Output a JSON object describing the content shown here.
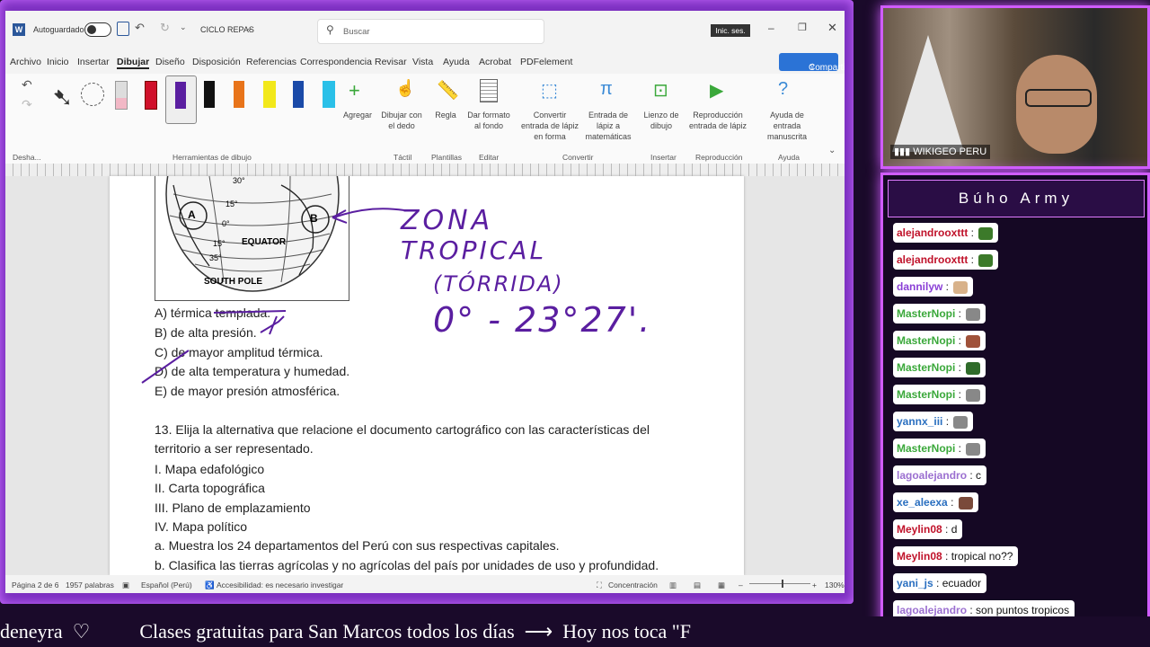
{
  "word": {
    "autosave_label": "Autoguardado",
    "doc_name": "CICLO REPAS",
    "search_placeholder": "Buscar",
    "signin_label": "Inic. ses.",
    "share_label": "Compartir",
    "menu": [
      "Archivo",
      "Inicio",
      "Insertar",
      "Dibujar",
      "Diseño",
      "Disposición",
      "Referencias",
      "Correspondencia",
      "Revisar",
      "Vista",
      "Ayuda",
      "Acrobat",
      "PDFelement"
    ],
    "ribbon": {
      "undo_group": "Desha...",
      "drawing_tools_group": "Herramientas de dibujo",
      "add_label": "Agregar",
      "draw_finger": "Dibujar con el dedo",
      "ruler": "Regla",
      "format_bg": "Dar formato al fondo",
      "ink_to_shape": "Convertir entrada de lápiz en forma",
      "ink_to_math": "Entrada de lápiz a matemáticas",
      "canvas": "Lienzo de dibujo",
      "ink_replay": "Reproducción entrada de lápiz",
      "ink_help": "Ayuda de entrada manuscrita",
      "groups": [
        "Táctil",
        "Plantillas",
        "Editar",
        "Convertir",
        "Insertar",
        "Reproducción",
        "Ayuda"
      ]
    },
    "figure": {
      "label_a": "A",
      "label_b": "B",
      "lat_30": "30°",
      "lat_15": "15°",
      "lat_0": "0°",
      "lat_s15": "15°",
      "lat_s35": "35°",
      "equator": "EQUATOR",
      "south_pole": "SOUTH POLE"
    },
    "options": [
      "A) térmica templada.",
      "B) de alta presión.",
      "C) de mayor amplitud térmica.",
      "D) de alta temperatura y humedad.",
      "E) de mayor presión atmosférica."
    ],
    "question_line1": "13. Elija la alternativa que relacione el documento cartográfico con las características del",
    "question_line2": "territorio a ser representado.",
    "items": [
      "I. Mapa edafológico",
      "II. Carta topográfica",
      "III. Plano de emplazamiento",
      "IV. Mapa político",
      "a. Muestra los 24 departamentos del Perú con sus respectivas capitales.",
      "b. Clasifica las tierras agrícolas y no agrícolas del país por unidades de uso y profundidad."
    ],
    "handwriting": {
      "line1": "ZONA",
      "line2": "TROPICAL",
      "line3": "(TÓRRIDA)",
      "line4": "0° - 23°27'."
    },
    "status": {
      "page": "Página 2 de 6",
      "words": "1957 palabras",
      "language": "Español (Perú)",
      "accessibility": "Accesibilidad: es necesario investigar",
      "focus": "Concentración",
      "zoom": "130%"
    }
  },
  "webcam": {
    "channel_label": "WIKIGEO PERU"
  },
  "chat": {
    "title": "Búho Army",
    "messages": [
      {
        "user": "alejandrooxttt",
        "text": "",
        "color": "#c0122a",
        "emote": "#3c7a2a"
      },
      {
        "user": "alejandrooxttt",
        "text": "",
        "color": "#c0122a",
        "emote": "#3c7a2a"
      },
      {
        "user": "dannilyw",
        "text": "",
        "color": "#8a3fd6",
        "emote": "#d8b28a"
      },
      {
        "user": "MasterNopi",
        "text": "",
        "color": "#3aa83a",
        "emote": "#888888"
      },
      {
        "user": "MasterNopi",
        "text": "",
        "color": "#3aa83a",
        "emote": "#a0523a"
      },
      {
        "user": "MasterNopi",
        "text": "",
        "color": "#3aa83a",
        "emote": "#2f6b2a"
      },
      {
        "user": "MasterNopi",
        "text": "",
        "color": "#3aa83a",
        "emote": "#888888"
      },
      {
        "user": "yannx_iii",
        "text": "",
        "color": "#2a6fc0",
        "emote": "#888888"
      },
      {
        "user": "MasterNopi",
        "text": "",
        "color": "#3aa83a",
        "emote": "#888888"
      },
      {
        "user": "lagoalejandro",
        "text": "c",
        "color": "#9b6fd0",
        "emote": ""
      },
      {
        "user": "xe_aleexa",
        "text": "",
        "color": "#2a6fc0",
        "emote": "#7a4a3a"
      },
      {
        "user": "Meylin08",
        "text": "d",
        "color": "#c0122a",
        "emote": ""
      },
      {
        "user": "Meylin08",
        "text": "tropical no??",
        "color": "#c0122a",
        "emote": ""
      },
      {
        "user": "yani_js",
        "text": "ecuador",
        "color": "#2a6fc0",
        "emote": ""
      },
      {
        "user": "lagoalejandro",
        "text": "son puntos tropicos",
        "color": "#9b6fd0",
        "emote": ""
      }
    ]
  },
  "ticker": {
    "text": "deneyra  ♡          Clases gratuitas para San Marcos todos los días  ⟶  Hoy nos toca \"F"
  },
  "colors": {
    "frame_purple": "#7b2fbf",
    "neon": "#d05cff",
    "word_blue": "#2b579a"
  }
}
